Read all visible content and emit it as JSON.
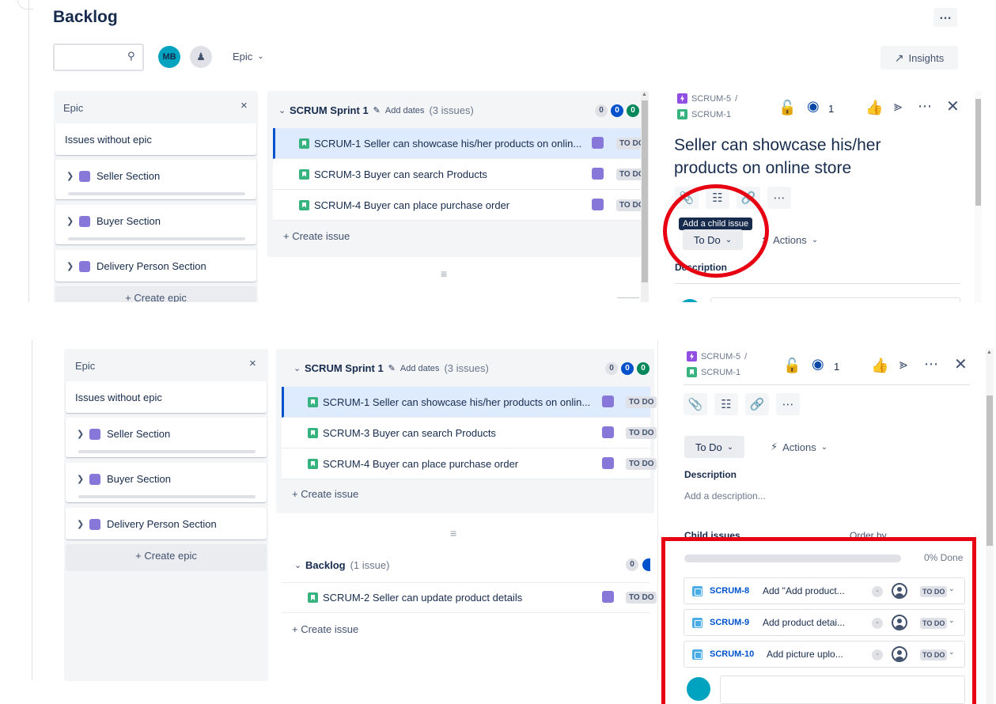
{
  "page": {
    "title": "Backlog",
    "more_label": "…",
    "insights_label": "Insights",
    "epic_filter_label": "Epic",
    "avatar_initials": "MB"
  },
  "epic_panel": {
    "title": "Epic",
    "close_label": "×",
    "no_epic_label": "Issues without epic",
    "epics": [
      {
        "name": "Seller Section"
      },
      {
        "name": "Buyer Section"
      },
      {
        "name": "Delivery Person Section"
      }
    ],
    "create_label": "+ Create epic"
  },
  "sprint": {
    "name": "SCRUM Sprint 1",
    "add_dates_label": "Add dates",
    "count_label": "(3 issues)",
    "counts": [
      "0",
      "0",
      "0"
    ],
    "issues": [
      {
        "key": "SCRUM-1",
        "summary": "Seller can showcase his/her products on onlin...",
        "status": "TO DO"
      },
      {
        "key": "SCRUM-3",
        "summary": "Buyer can search Products",
        "status": "TO DO"
      },
      {
        "key": "SCRUM-4",
        "summary": "Buyer can place purchase order",
        "status": "TO DO"
      }
    ],
    "create_issue_label": "+ Create issue"
  },
  "backlog": {
    "name": "Backlog",
    "count_label": "(1 issue)",
    "count": "0",
    "issues": [
      {
        "key": "SCRUM-2",
        "summary": "Seller can update product details",
        "status": "TO DO"
      }
    ],
    "create_issue_label": "+ Create issue"
  },
  "detail": {
    "parent_key": "SCRUM-5",
    "separator": "/",
    "issue_key": "SCRUM-1",
    "watch_count": "1",
    "title_line1": "Seller can showcase his/her",
    "title_line2": "products on online store",
    "tooltip": "Add a child issue",
    "status_label": "To Do",
    "actions_label": "Actions",
    "description_label": "Description",
    "description_placeholder": "Add a description...",
    "child_issues_label": "Child issues",
    "order_by_label": "Order by",
    "progress_label": "0% Done",
    "progress_fraction": 0,
    "children": [
      {
        "key": "SCRUM-8",
        "summary": "Add \"Add product...",
        "status": "TO DO"
      },
      {
        "key": "SCRUM-9",
        "summary": "Add product detai...",
        "status": "TO DO"
      },
      {
        "key": "SCRUM-10",
        "summary": "Add picture uplo...",
        "status": "TO DO"
      }
    ]
  },
  "colors": {
    "annotation_red": "#e60012",
    "selected_row": "#deebff",
    "epic_purple": "#8777d9",
    "story_green": "#36b37e",
    "subtask_blue": "#4bade8",
    "avatar_teal": "#00a3bf"
  }
}
